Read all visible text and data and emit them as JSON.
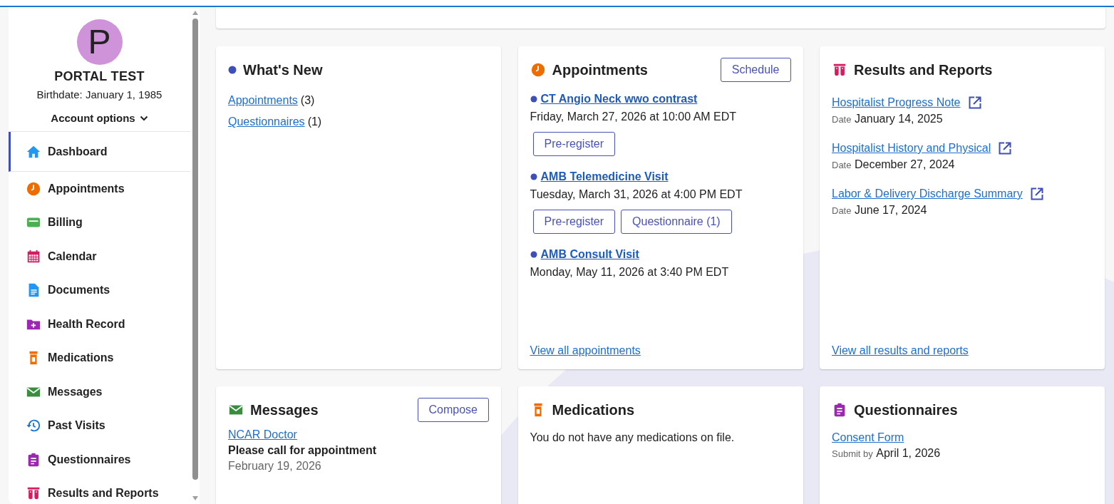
{
  "profile": {
    "initial": "P",
    "name": "PORTAL TEST",
    "birthdate": "Birthdate: January 1, 1985",
    "account_options": "Account options"
  },
  "sidebar": {
    "items": [
      {
        "label": "Dashboard",
        "selected": true
      },
      {
        "label": "Appointments",
        "selected": false
      },
      {
        "label": "Billing",
        "selected": false
      },
      {
        "label": "Calendar",
        "selected": false
      },
      {
        "label": "Documents",
        "selected": false
      },
      {
        "label": "Health Record",
        "selected": false
      },
      {
        "label": "Medications",
        "selected": false
      },
      {
        "label": "Messages",
        "selected": false
      },
      {
        "label": "Past Visits",
        "selected": false
      },
      {
        "label": "Questionnaires",
        "selected": false
      },
      {
        "label": "Results and Reports",
        "selected": false
      }
    ]
  },
  "whats_new": {
    "title": "What's New",
    "items": [
      {
        "link": "Appointments",
        "count": "(3)"
      },
      {
        "link": "Questionnaires",
        "count": "(1)"
      }
    ]
  },
  "appointments": {
    "title": "Appointments",
    "button": "Schedule",
    "items": [
      {
        "title": "CT Angio Neck wwo contrast",
        "datetime": "Friday, March 27, 2026 at 10:00 AM EDT",
        "buttons": [
          "Pre-register"
        ]
      },
      {
        "title": "AMB Telemedicine Visit",
        "datetime": "Tuesday, March 31, 2026 at 4:00 PM EDT",
        "buttons": [
          "Pre-register",
          "Questionnaire (1)"
        ]
      },
      {
        "title": "AMB Consult Visit",
        "datetime": "Monday, May 11, 2026 at 3:40 PM EDT"
      }
    ],
    "footer_link": "View all appointments"
  },
  "results": {
    "title": "Results and Reports",
    "items": [
      {
        "title": "Hospitalist Progress Note",
        "date_label": "Date",
        "date": "January 14, 2025"
      },
      {
        "title": "Hospitalist History and Physical",
        "date_label": "Date",
        "date": "December 27, 2024"
      },
      {
        "title": "Labor & Delivery Discharge Summary",
        "date_label": "Date",
        "date": "June 17, 2024"
      }
    ],
    "footer_link": "View all results and reports"
  },
  "messages": {
    "title": "Messages",
    "button": "Compose",
    "items": [
      {
        "sender": "NCAR Doctor",
        "subject": "Please call for appointment",
        "date": "February 19, 2026"
      }
    ]
  },
  "medications": {
    "title": "Medications",
    "empty_text": "You do not have any medications on file."
  },
  "questionnaires": {
    "title": "Questionnaires",
    "items": [
      {
        "title": "Consent Form",
        "due_label": "Submit by",
        "due": "April 1, 2026"
      }
    ]
  }
}
